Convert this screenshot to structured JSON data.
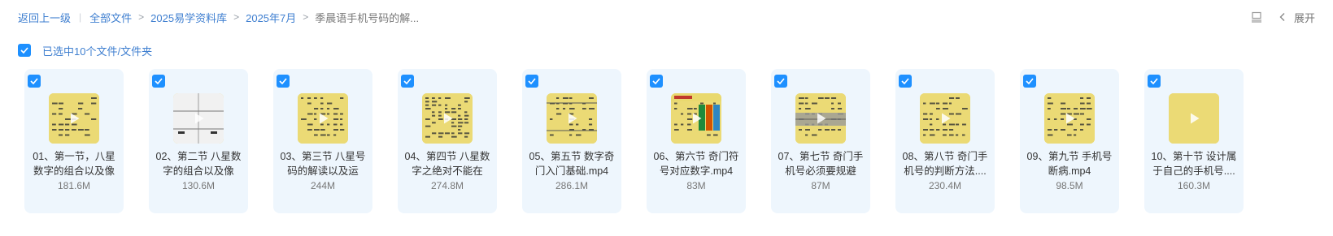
{
  "breadcrumb": {
    "back": "返回上一级",
    "items": [
      "全部文件",
      "2025易学资料库",
      "2025年7月"
    ],
    "current": "季晨语手机号码的解..."
  },
  "toolbar": {
    "view_icon": "list-view-icon",
    "expand_icon": "chevron-left-icon",
    "expand_label": "展开"
  },
  "selection": {
    "label": "已选中10个文件/文件夹",
    "checked": true
  },
  "colors": {
    "accent": "#1e90ff",
    "link": "#3f7fd0",
    "card_bg": "#eef6fd",
    "thumb_yellow": "#e9d56a"
  },
  "files": [
    {
      "name": "01、第一节，八星数字的组合以及像",
      "size": "181.6M",
      "thumb": "yellow-text",
      "checked": true
    },
    {
      "name": "02、第二节 八星数字的组合以及像",
      "size": "130.6M",
      "thumb": "white-grid",
      "checked": true
    },
    {
      "name": "03、第三节 八星号码的解读以及运",
      "size": "244M",
      "thumb": "yellow-text",
      "checked": true
    },
    {
      "name": "04、第四节 八星数字之绝对不能在",
      "size": "274.8M",
      "thumb": "yellow-dense",
      "checked": true
    },
    {
      "name": "05、第五节 数字奇门入门基础.mp4",
      "size": "286.1M",
      "thumb": "yellow-lines",
      "checked": true
    },
    {
      "name": "06、第六节 奇门符号对应数字.mp4",
      "size": "83M",
      "thumb": "yellow-chart",
      "checked": true
    },
    {
      "name": "07、第七节 奇门手机号必须要规避",
      "size": "87M",
      "thumb": "yellow-table",
      "checked": true
    },
    {
      "name": "08、第八节 奇门手机号的判断方法....",
      "size": "230.4M",
      "thumb": "yellow-text",
      "checked": true
    },
    {
      "name": "09、第九节 手机号断病.mp4",
      "size": "98.5M",
      "thumb": "yellow-text",
      "checked": true
    },
    {
      "name": "10、第十节 设计属于自己的手机号....",
      "size": "160.3M",
      "thumb": "yellow-plain",
      "checked": true
    }
  ]
}
